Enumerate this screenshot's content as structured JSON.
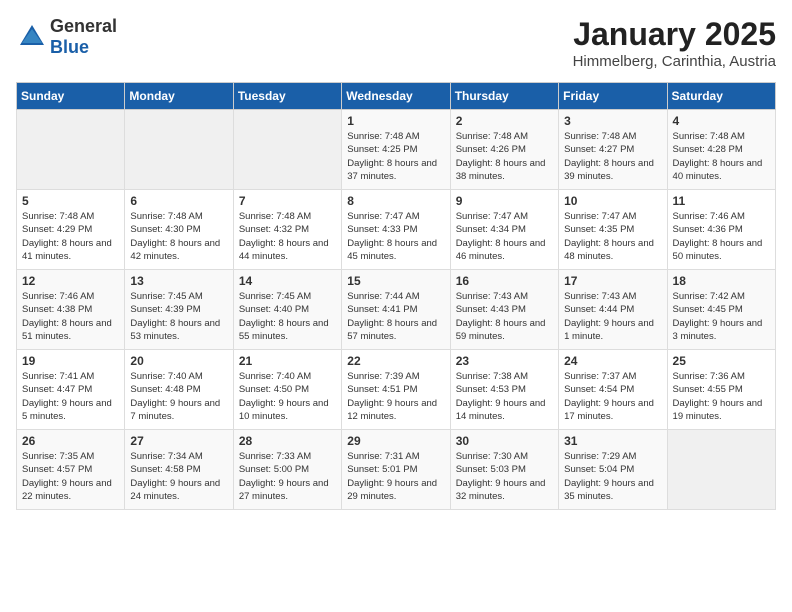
{
  "header": {
    "logo_general": "General",
    "logo_blue": "Blue",
    "title": "January 2025",
    "subtitle": "Himmelberg, Carinthia, Austria"
  },
  "calendar": {
    "days_of_week": [
      "Sunday",
      "Monday",
      "Tuesday",
      "Wednesday",
      "Thursday",
      "Friday",
      "Saturday"
    ],
    "weeks": [
      [
        {
          "day": "",
          "empty": true
        },
        {
          "day": "",
          "empty": true
        },
        {
          "day": "",
          "empty": true
        },
        {
          "day": "1",
          "sunrise": "7:48 AM",
          "sunset": "4:25 PM",
          "daylight": "8 hours and 37 minutes."
        },
        {
          "day": "2",
          "sunrise": "7:48 AM",
          "sunset": "4:26 PM",
          "daylight": "8 hours and 38 minutes."
        },
        {
          "day": "3",
          "sunrise": "7:48 AM",
          "sunset": "4:27 PM",
          "daylight": "8 hours and 39 minutes."
        },
        {
          "day": "4",
          "sunrise": "7:48 AM",
          "sunset": "4:28 PM",
          "daylight": "8 hours and 40 minutes."
        }
      ],
      [
        {
          "day": "5",
          "sunrise": "7:48 AM",
          "sunset": "4:29 PM",
          "daylight": "8 hours and 41 minutes."
        },
        {
          "day": "6",
          "sunrise": "7:48 AM",
          "sunset": "4:30 PM",
          "daylight": "8 hours and 42 minutes."
        },
        {
          "day": "7",
          "sunrise": "7:48 AM",
          "sunset": "4:32 PM",
          "daylight": "8 hours and 44 minutes."
        },
        {
          "day": "8",
          "sunrise": "7:47 AM",
          "sunset": "4:33 PM",
          "daylight": "8 hours and 45 minutes."
        },
        {
          "day": "9",
          "sunrise": "7:47 AM",
          "sunset": "4:34 PM",
          "daylight": "8 hours and 46 minutes."
        },
        {
          "day": "10",
          "sunrise": "7:47 AM",
          "sunset": "4:35 PM",
          "daylight": "8 hours and 48 minutes."
        },
        {
          "day": "11",
          "sunrise": "7:46 AM",
          "sunset": "4:36 PM",
          "daylight": "8 hours and 50 minutes."
        }
      ],
      [
        {
          "day": "12",
          "sunrise": "7:46 AM",
          "sunset": "4:38 PM",
          "daylight": "8 hours and 51 minutes."
        },
        {
          "day": "13",
          "sunrise": "7:45 AM",
          "sunset": "4:39 PM",
          "daylight": "8 hours and 53 minutes."
        },
        {
          "day": "14",
          "sunrise": "7:45 AM",
          "sunset": "4:40 PM",
          "daylight": "8 hours and 55 minutes."
        },
        {
          "day": "15",
          "sunrise": "7:44 AM",
          "sunset": "4:41 PM",
          "daylight": "8 hours and 57 minutes."
        },
        {
          "day": "16",
          "sunrise": "7:43 AM",
          "sunset": "4:43 PM",
          "daylight": "8 hours and 59 minutes."
        },
        {
          "day": "17",
          "sunrise": "7:43 AM",
          "sunset": "4:44 PM",
          "daylight": "9 hours and 1 minute."
        },
        {
          "day": "18",
          "sunrise": "7:42 AM",
          "sunset": "4:45 PM",
          "daylight": "9 hours and 3 minutes."
        }
      ],
      [
        {
          "day": "19",
          "sunrise": "7:41 AM",
          "sunset": "4:47 PM",
          "daylight": "9 hours and 5 minutes."
        },
        {
          "day": "20",
          "sunrise": "7:40 AM",
          "sunset": "4:48 PM",
          "daylight": "9 hours and 7 minutes."
        },
        {
          "day": "21",
          "sunrise": "7:40 AM",
          "sunset": "4:50 PM",
          "daylight": "9 hours and 10 minutes."
        },
        {
          "day": "22",
          "sunrise": "7:39 AM",
          "sunset": "4:51 PM",
          "daylight": "9 hours and 12 minutes."
        },
        {
          "day": "23",
          "sunrise": "7:38 AM",
          "sunset": "4:53 PM",
          "daylight": "9 hours and 14 minutes."
        },
        {
          "day": "24",
          "sunrise": "7:37 AM",
          "sunset": "4:54 PM",
          "daylight": "9 hours and 17 minutes."
        },
        {
          "day": "25",
          "sunrise": "7:36 AM",
          "sunset": "4:55 PM",
          "daylight": "9 hours and 19 minutes."
        }
      ],
      [
        {
          "day": "26",
          "sunrise": "7:35 AM",
          "sunset": "4:57 PM",
          "daylight": "9 hours and 22 minutes."
        },
        {
          "day": "27",
          "sunrise": "7:34 AM",
          "sunset": "4:58 PM",
          "daylight": "9 hours and 24 minutes."
        },
        {
          "day": "28",
          "sunrise": "7:33 AM",
          "sunset": "5:00 PM",
          "daylight": "9 hours and 27 minutes."
        },
        {
          "day": "29",
          "sunrise": "7:31 AM",
          "sunset": "5:01 PM",
          "daylight": "9 hours and 29 minutes."
        },
        {
          "day": "30",
          "sunrise": "7:30 AM",
          "sunset": "5:03 PM",
          "daylight": "9 hours and 32 minutes."
        },
        {
          "day": "31",
          "sunrise": "7:29 AM",
          "sunset": "5:04 PM",
          "daylight": "9 hours and 35 minutes."
        },
        {
          "day": "",
          "empty": true
        }
      ]
    ]
  }
}
